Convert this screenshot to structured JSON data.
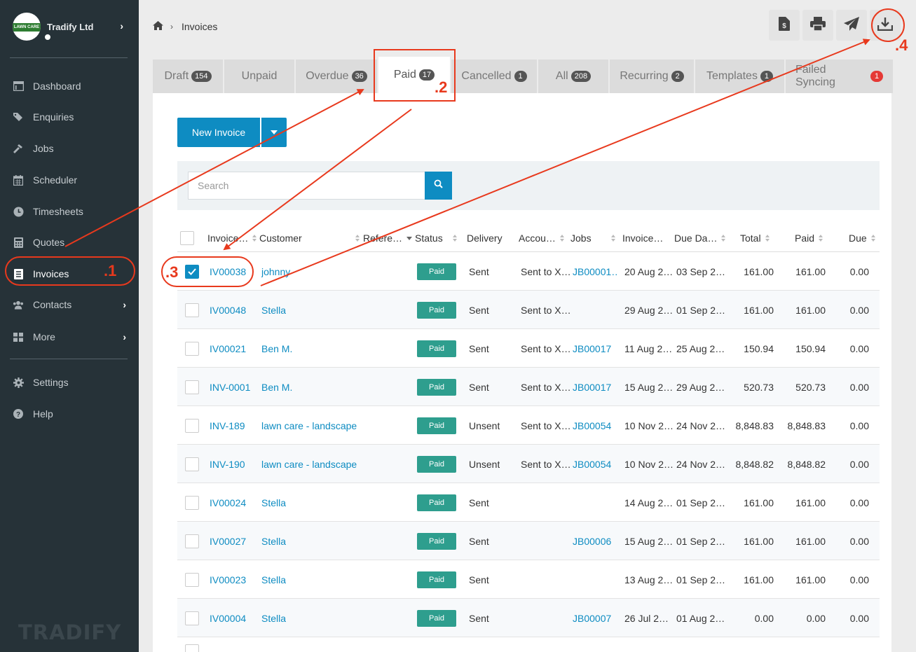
{
  "brand": {
    "name": "Tradify Ltd",
    "logo_text": "LAWN CARE",
    "watermark": "TRADIFY"
  },
  "sidebar": {
    "items": [
      {
        "label": "Dashboard",
        "icon": "dashboard-icon"
      },
      {
        "label": "Enquiries",
        "icon": "tags-icon"
      },
      {
        "label": "Jobs",
        "icon": "hammer-icon"
      },
      {
        "label": "Scheduler",
        "icon": "calendar-icon"
      },
      {
        "label": "Timesheets",
        "icon": "clock-icon"
      },
      {
        "label": "Quotes",
        "icon": "calculator-icon"
      },
      {
        "label": "Invoices",
        "icon": "document-icon",
        "active": true
      },
      {
        "label": "Contacts",
        "icon": "users-icon"
      },
      {
        "label": "More",
        "icon": "grid-icon"
      },
      {
        "label": "Settings",
        "icon": "gear-icon"
      },
      {
        "label": "Help",
        "icon": "question-icon"
      }
    ]
  },
  "breadcrumb": {
    "current": "Invoices"
  },
  "tabs": [
    {
      "label": "Draft",
      "count": "154"
    },
    {
      "label": "Unpaid",
      "count": ""
    },
    {
      "label": "Overdue",
      "count": "36"
    },
    {
      "label": "Paid",
      "count": "17",
      "active": true
    },
    {
      "label": "Cancelled",
      "count": "1"
    },
    {
      "label": "All",
      "count": "208"
    },
    {
      "label": "Recurring",
      "count": "2"
    },
    {
      "label": "Templates",
      "count": "1"
    },
    {
      "label": "Failed Syncing",
      "count": "1"
    }
  ],
  "new_invoice_label": "New Invoice",
  "search": {
    "placeholder": "Search"
  },
  "columns": {
    "invoice": "Invoice…",
    "customer": "Customer",
    "reference": "Refere…",
    "status": "Status",
    "delivery": "Delivery",
    "accounting": "Accou…",
    "jobs": "Jobs",
    "invoice_date": "Invoice…",
    "due_date": "Due Da…",
    "total": "Total",
    "paid": "Paid",
    "due": "Due"
  },
  "rows": [
    {
      "invoice": "IV00038",
      "customer": "johnny",
      "status": "Paid",
      "delivery": "Sent",
      "accounting": "Sent to X…",
      "job": "JB00001…",
      "invoice_date": "20 Aug 2…",
      "due_date": "03 Sep 2…",
      "total": "161.00",
      "paid": "161.00",
      "due": "0.00",
      "checked": true
    },
    {
      "invoice": "IV00048",
      "customer": "Stella",
      "status": "Paid",
      "delivery": "Sent",
      "accounting": "Sent to X…",
      "job": "",
      "invoice_date": "29 Aug 2…",
      "due_date": "01 Sep 2…",
      "total": "161.00",
      "paid": "161.00",
      "due": "0.00"
    },
    {
      "invoice": "IV00021",
      "customer": "Ben M.",
      "status": "Paid",
      "delivery": "Sent",
      "accounting": "Sent to X…",
      "job": "JB00017",
      "invoice_date": "11 Aug 2…",
      "due_date": "25 Aug 2…",
      "total": "150.94",
      "paid": "150.94",
      "due": "0.00"
    },
    {
      "invoice": "INV-0001",
      "customer": "Ben M.",
      "status": "Paid",
      "delivery": "Sent",
      "accounting": "Sent to X…",
      "job": "JB00017",
      "invoice_date": "15 Aug 2…",
      "due_date": "29 Aug 2…",
      "total": "520.73",
      "paid": "520.73",
      "due": "0.00"
    },
    {
      "invoice": "INV-189",
      "customer": "lawn care - landscape",
      "status": "Paid",
      "delivery": "Unsent",
      "accounting": "Sent to X…",
      "job": "JB00054",
      "invoice_date": "10 Nov 2…",
      "due_date": "24 Nov 2…",
      "total": "8,848.83",
      "paid": "8,848.83",
      "due": "0.00"
    },
    {
      "invoice": "INV-190",
      "customer": "lawn care - landscape",
      "status": "Paid",
      "delivery": "Unsent",
      "accounting": "Sent to X…",
      "job": "JB00054",
      "invoice_date": "10 Nov 2…",
      "due_date": "24 Nov 2…",
      "total": "8,848.82",
      "paid": "8,848.82",
      "due": "0.00"
    },
    {
      "invoice": "IV00024",
      "customer": "Stella",
      "status": "Paid",
      "delivery": "Sent",
      "accounting": "",
      "job": "",
      "invoice_date": "14 Aug 2…",
      "due_date": "01 Sep 2…",
      "total": "161.00",
      "paid": "161.00",
      "due": "0.00"
    },
    {
      "invoice": "IV00027",
      "customer": "Stella",
      "status": "Paid",
      "delivery": "Sent",
      "accounting": "",
      "job": "JB00006",
      "invoice_date": "15 Aug 2…",
      "due_date": "01 Sep 2…",
      "total": "161.00",
      "paid": "161.00",
      "due": "0.00"
    },
    {
      "invoice": "IV00023",
      "customer": "Stella",
      "status": "Paid",
      "delivery": "Sent",
      "accounting": "",
      "job": "",
      "invoice_date": "13 Aug 2…",
      "due_date": "01 Sep 2…",
      "total": "161.00",
      "paid": "161.00",
      "due": "0.00"
    },
    {
      "invoice": "IV00004",
      "customer": "Stella",
      "status": "Paid",
      "delivery": "Sent",
      "accounting": "",
      "job": "JB00007",
      "invoice_date": "26 Jul 2…",
      "due_date": "01 Aug 2…",
      "total": "0.00",
      "paid": "0.00",
      "due": "0.00"
    }
  ],
  "annotations": [
    ".1",
    ".2",
    ".3",
    ".4"
  ],
  "colors": {
    "sidebar": "#263238",
    "accent": "#0e8cc2",
    "paid_badge": "#2e9e8e",
    "annotation": "#e8391d"
  }
}
